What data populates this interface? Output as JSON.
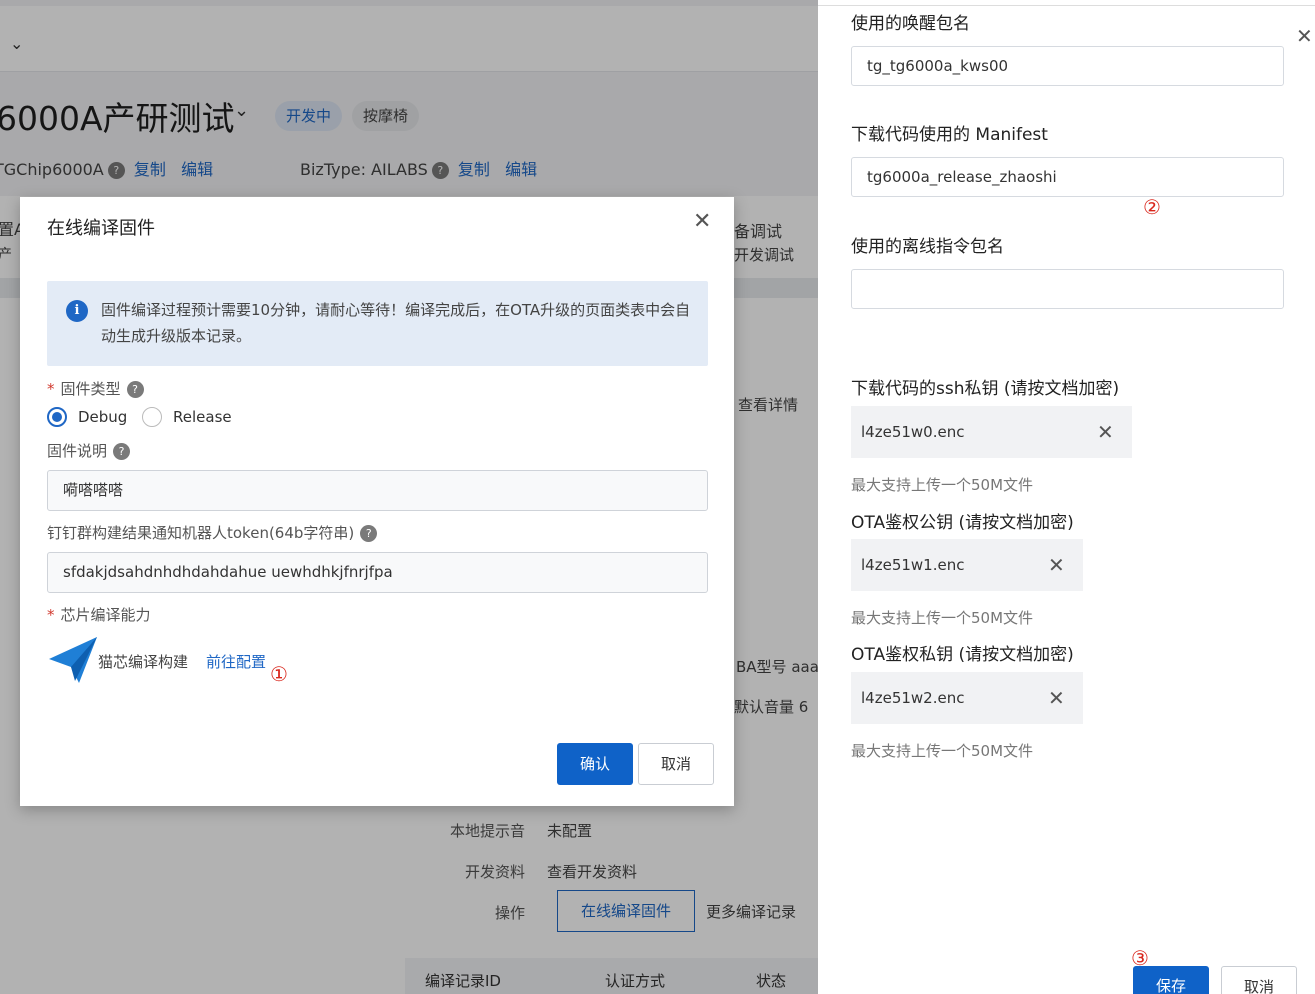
{
  "background": {
    "title": "6000A产研测试",
    "status_tag": "开发中",
    "category_tag": "按摩椅",
    "chip_meta": "TGChip6000A",
    "biz_meta": "BizType: AILABS",
    "copy_label": "复制",
    "edit_label": "编辑",
    "frag_left_1": "置A",
    "frag_left_2": "产",
    "frag_debug_1": "备调试",
    "frag_debug_2": "开发调试",
    "view_detail": "查看详情",
    "frag_model": "BA型号 aaa",
    "frag_volume": "默认音量 6",
    "local_prompt_label": "本地提示音",
    "local_prompt_value": "未配置",
    "dev_docs_label": "开发资料",
    "dev_docs_value": "查看开发资料",
    "ops_label": "操作",
    "online_compile_button": "在线编译固件",
    "more_records_link": "更多编译记录",
    "table_headers": [
      "编译记录ID",
      "认证方式",
      "状态"
    ]
  },
  "modal": {
    "title": "在线编译固件",
    "info": "固件编译过程预计需要10分钟，请耐心等待！编译完成后，在OTA升级的页面类表中会自动生成升级版本记录。",
    "firmware_type_label": "固件类型",
    "options": [
      "Debug",
      "Release"
    ],
    "selected_option": "Debug",
    "firmware_desc_label": "固件说明",
    "firmware_desc_value": "嗬嗒嗒嗒",
    "token_label": "钉钉群构建结果通知机器人token(64b字符串)",
    "token_value": "sfdakjdsahdnhdhdahdahue uewhdhkjfnrjfpa",
    "chip_label": "芯片编译能力",
    "chip_name": "猫芯编译构建",
    "chip_link": "前往配置",
    "confirm": "确认",
    "cancel": "取消"
  },
  "markers": [
    "①",
    "②",
    "③"
  ],
  "drawer": {
    "wake_label": "使用的唤醒包名",
    "wake_value": "tg_tg6000a_kws00",
    "manifest_label": "下载代码使用的 Manifest",
    "manifest_value": "tg6000a_release_zhaoshi",
    "offline_label": "使用的离线指令包名",
    "offline_value": "",
    "ssh_label": "下载代码的ssh私钥 (请按文档加密)",
    "ssh_file": "l4ze51w0.enc",
    "ota_pub_label": "OTA鉴权公钥 (请按文档加密)",
    "ota_pub_file": "l4ze51w1.enc",
    "ota_priv_label": "OTA鉴权私钥 (请按文档加密)",
    "ota_priv_file": "l4ze51w2.enc",
    "hint": "最大支持上传一个50M文件",
    "save": "保存",
    "cancel": "取消"
  },
  "colors": {
    "primary": "#0f62c8",
    "marker": "#d9261c",
    "link": "#1f67c5"
  }
}
